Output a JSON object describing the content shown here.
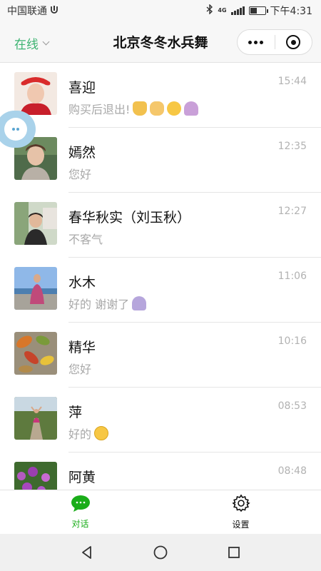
{
  "status_bar": {
    "carrier": "中国联通",
    "network": "4G",
    "time": "下午4:31"
  },
  "header": {
    "status_label": "在线",
    "title": "北京冬冬水兵舞"
  },
  "colors": {
    "accent": "#3cb371",
    "tab_active": "#1aad19",
    "bubble": "#a9d2ea"
  },
  "chats": [
    {
      "name": "喜迎",
      "time": "15:44",
      "preview": "购买后退出!",
      "emojis": [
        "thumbs-up-icon",
        "ok-hand-icon",
        "thinking-face-icon",
        "praying-hands-icon"
      ]
    },
    {
      "name": "嫣然",
      "time": "12:35",
      "preview": "您好",
      "emojis": []
    },
    {
      "name": "春华秋实（刘玉秋）",
      "time": "12:27",
      "preview": "不客气",
      "emojis": []
    },
    {
      "name": "水木",
      "time": "11:06",
      "preview": "好的 谢谢了",
      "emojis": [
        "praying-hands-icon"
      ]
    },
    {
      "name": "精华",
      "time": "10:16",
      "preview": "您好",
      "emojis": []
    },
    {
      "name": "萍",
      "time": "08:53",
      "preview": "好的",
      "emojis": [
        "smiling-face-icon"
      ]
    },
    {
      "name": "阿黄",
      "time": "08:48",
      "preview": "",
      "emojis": []
    }
  ],
  "tabs": [
    {
      "label": "对话",
      "icon": "chat-bubble-icon",
      "active": true
    },
    {
      "label": "设置",
      "icon": "gear-icon",
      "active": false
    }
  ]
}
